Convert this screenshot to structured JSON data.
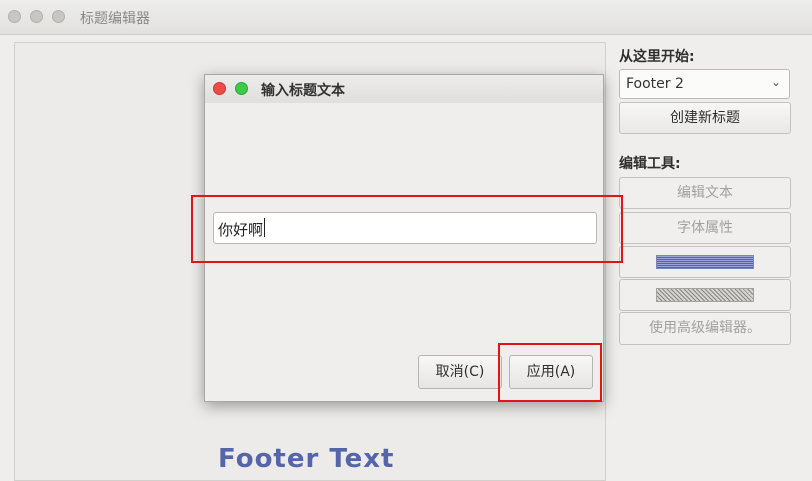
{
  "window": {
    "title": "标题编辑器"
  },
  "canvas": {
    "footer_text": "Footer Text"
  },
  "panel": {
    "start_label": "从这里开始:",
    "template_select": {
      "value": "Footer 2"
    },
    "create_button": "创建新标题",
    "tools_label": "编辑工具:",
    "edit_text_button": "编辑文本",
    "font_props_button": "字体属性",
    "advanced_editor_button": "使用高级编辑器。"
  },
  "dialog": {
    "title": "输入标题文本",
    "input_value": "你好啊",
    "cancel_button": "取消(C)",
    "apply_button": "应用(A)"
  },
  "colors": {
    "highlight": "#e01515",
    "footer_text": "#5566a8",
    "close": "#ef4a4a",
    "maximize": "#40c84a"
  }
}
